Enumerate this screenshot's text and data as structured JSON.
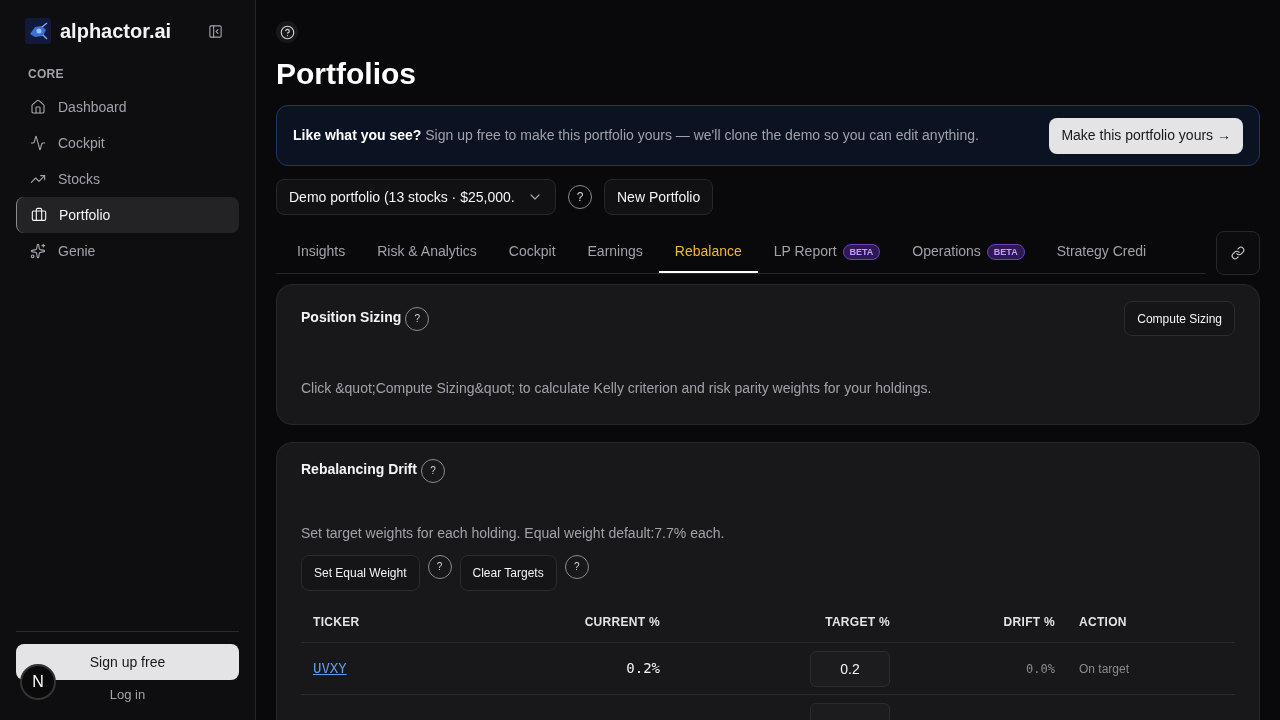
{
  "sidebar": {
    "brand": "alphactor.ai",
    "section_label": "CORE",
    "items": [
      {
        "label": "Dashboard",
        "selected": false
      },
      {
        "label": "Cockpit",
        "selected": false
      },
      {
        "label": "Stocks",
        "selected": false
      },
      {
        "label": "Portfolio",
        "selected": true
      },
      {
        "label": "Genie",
        "selected": false
      }
    ],
    "signup_button": "Sign up free",
    "login_link": "Log in"
  },
  "dev_tools_button": "N",
  "page": {
    "title": "Portfolios"
  },
  "banner": {
    "lead": "Like what you see?",
    "text": "Sign up free to make this portfolio yours — we'll clone the demo so you can edit anything.",
    "button": "Make this portfolio yours →"
  },
  "portfolio_bar": {
    "select_value": "Demo portfolio (13 stocks · $25,000.",
    "help": "?",
    "new_button": "New Portfolio"
  },
  "tabs": [
    {
      "label": "Insights",
      "selected": false
    },
    {
      "label": "Risk & Analytics",
      "selected": false
    },
    {
      "label": "Cockpit",
      "selected": false
    },
    {
      "label": "Earnings",
      "selected": false
    },
    {
      "label": "Rebalance",
      "selected": true
    },
    {
      "label": "LP Report",
      "badge": "BETA",
      "selected": false
    },
    {
      "label": "Operations",
      "badge": "BETA",
      "selected": false
    },
    {
      "label": "Strategy Credi",
      "selected": false
    }
  ],
  "position_sizing": {
    "title": "Position Sizing",
    "help": "?",
    "button": "Compute Sizing",
    "description": "Click &quot;Compute Sizing&quot; to calculate Kelly criterion and risk parity weights for your holdings."
  },
  "rebalancing_drift": {
    "title": "Rebalancing Drift",
    "help": "?",
    "description": "Set target weights for each holding. Equal weight default:7.7% each.",
    "buttons": [
      {
        "label": "Set Equal Weight",
        "help": "?"
      },
      {
        "label": "Clear Targets",
        "help": "?"
      }
    ],
    "table": {
      "columns": [
        "TICKER",
        "CURRENT %",
        "TARGET %",
        "DRIFT %",
        "ACTION"
      ],
      "rows": [
        {
          "ticker": "UVXY",
          "current": "0.2%",
          "target": "0.2",
          "drift": "0.0%",
          "action": "On target"
        },
        {}
      ]
    }
  }
}
